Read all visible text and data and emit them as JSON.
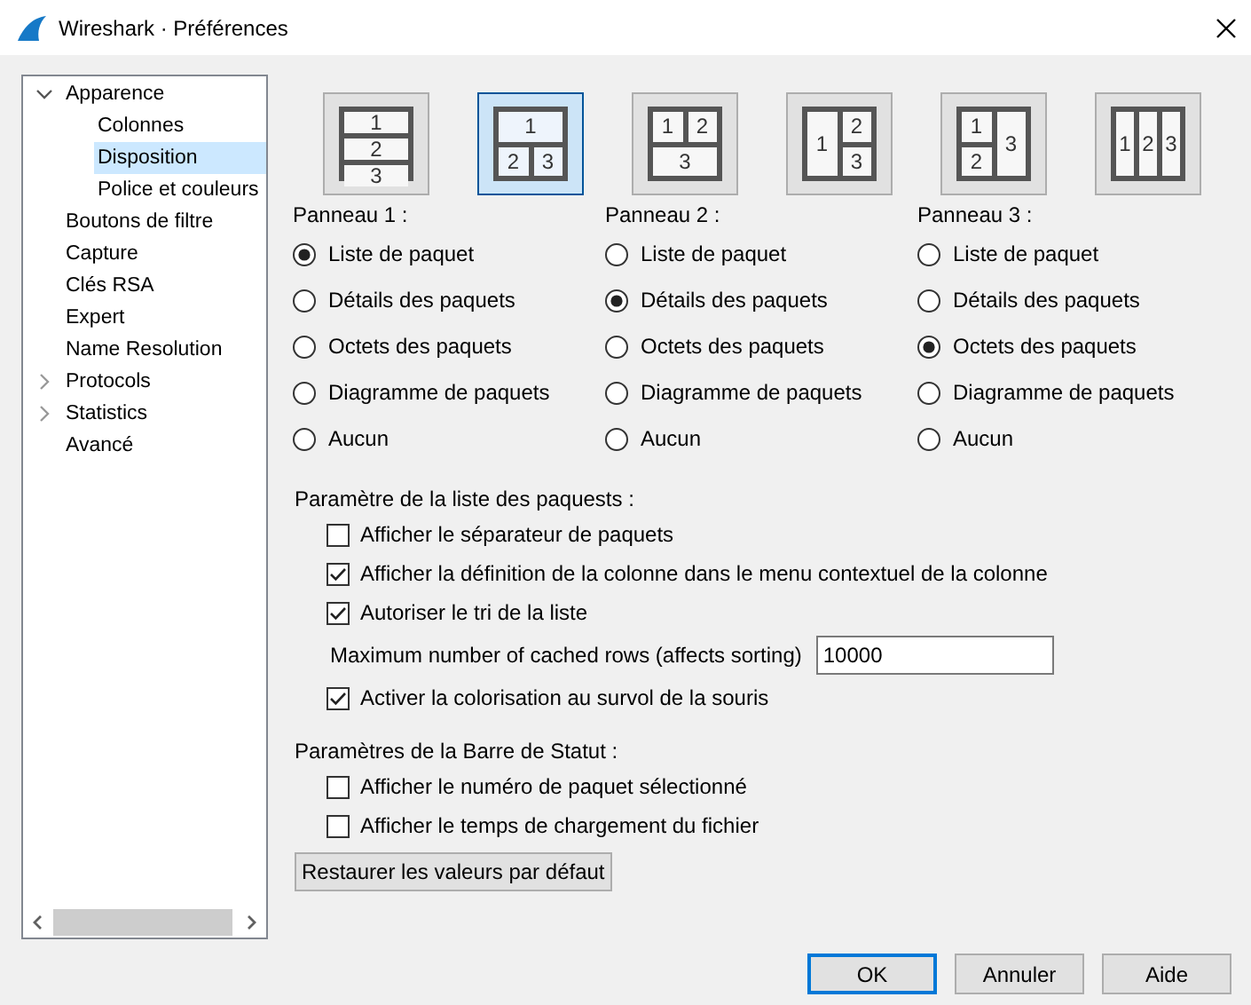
{
  "window": {
    "title": "Wireshark · Préférences"
  },
  "sidebar": {
    "items": [
      {
        "label": "Apparence",
        "expanded": true,
        "selected": false,
        "children": [
          {
            "label": "Colonnes",
            "selected": false
          },
          {
            "label": "Disposition",
            "selected": true
          },
          {
            "label": "Police et couleurs",
            "selected": false
          }
        ]
      },
      {
        "label": "Boutons de filtre",
        "selected": false
      },
      {
        "label": "Capture",
        "selected": false
      },
      {
        "label": "Clés RSA",
        "selected": false
      },
      {
        "label": "Expert",
        "selected": false
      },
      {
        "label": "Name Resolution",
        "selected": false
      },
      {
        "label": "Protocols",
        "expanded": false,
        "selected": false
      },
      {
        "label": "Statistics",
        "expanded": false,
        "selected": false
      },
      {
        "label": "Avancé",
        "selected": false
      }
    ]
  },
  "layouts": [
    {
      "kind": "rows",
      "selected": false,
      "panes": [
        "1",
        "2",
        "3"
      ]
    },
    {
      "kind": "top-split",
      "selected": true,
      "panes": [
        "1",
        "2",
        "3"
      ]
    },
    {
      "kind": "split-top",
      "selected": false,
      "panes": [
        "1",
        "2",
        "3"
      ]
    },
    {
      "kind": "left-split",
      "selected": false,
      "panes": [
        "1",
        "2",
        "3"
      ]
    },
    {
      "kind": "left-stack-right",
      "selected": false,
      "panes": [
        "1",
        "2",
        "3"
      ]
    },
    {
      "kind": "columns",
      "selected": false,
      "panes": [
        "1",
        "2",
        "3"
      ]
    }
  ],
  "panels": [
    {
      "title": "Panneau 1 :",
      "options": [
        {
          "label": "Liste de paquet",
          "selected": true
        },
        {
          "label": "Détails des paquets",
          "selected": false
        },
        {
          "label": "Octets des paquets",
          "selected": false
        },
        {
          "label": "Diagramme de paquets",
          "selected": false
        },
        {
          "label": "Aucun",
          "selected": false
        }
      ]
    },
    {
      "title": "Panneau 2 :",
      "options": [
        {
          "label": "Liste de paquet",
          "selected": false
        },
        {
          "label": "Détails des paquets",
          "selected": true
        },
        {
          "label": "Octets des paquets",
          "selected": false
        },
        {
          "label": "Diagramme de paquets",
          "selected": false
        },
        {
          "label": "Aucun",
          "selected": false
        }
      ]
    },
    {
      "title": "Panneau 3 :",
      "options": [
        {
          "label": "Liste de paquet",
          "selected": false
        },
        {
          "label": "Détails des paquets",
          "selected": false
        },
        {
          "label": "Octets des paquets",
          "selected": true
        },
        {
          "label": "Diagramme de paquets",
          "selected": false
        },
        {
          "label": "Aucun",
          "selected": false
        }
      ]
    }
  ],
  "packet_list_settings": {
    "title": "Paramètre de la liste des paquests :",
    "items": [
      {
        "kind": "checkbox",
        "label": "Afficher le séparateur de paquets",
        "checked": false
      },
      {
        "kind": "checkbox",
        "label": "Afficher la définition de la colonne dans le menu contextuel de la colonne",
        "checked": true
      },
      {
        "kind": "checkbox",
        "label": "Autoriser le tri de la liste",
        "checked": true
      },
      {
        "kind": "number",
        "label": "Maximum number of cached rows (affects sorting)",
        "value": "10000"
      },
      {
        "kind": "checkbox",
        "label": "Activer la colorisation au survol de la souris",
        "checked": true
      }
    ]
  },
  "status_bar_settings": {
    "title": "Paramètres de la Barre de Statut :",
    "items": [
      {
        "kind": "checkbox",
        "label": "Afficher le numéro de paquet sélectionné",
        "checked": false
      },
      {
        "kind": "checkbox",
        "label": "Afficher le temps de chargement du fichier",
        "checked": false
      }
    ]
  },
  "restore_button": "Restaurer les valeurs par défaut",
  "buttons": [
    {
      "label": "OK",
      "default": true
    },
    {
      "label": "Annuler",
      "default": false
    },
    {
      "label": "Aide",
      "default": false
    }
  ]
}
